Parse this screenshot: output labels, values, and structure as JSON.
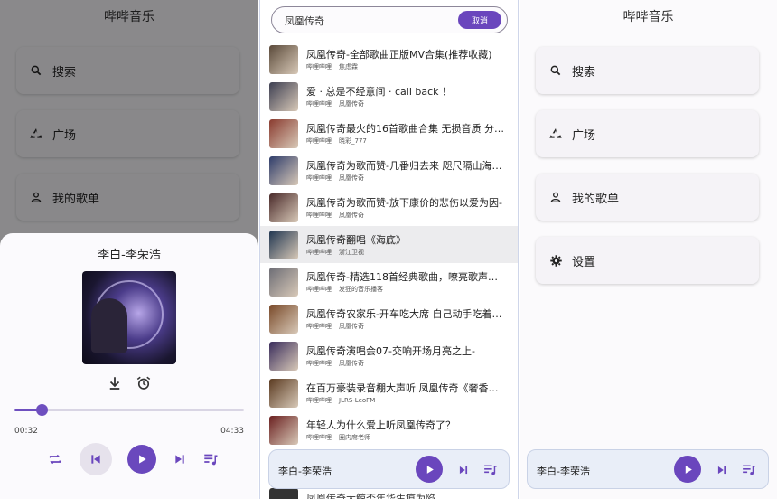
{
  "home": {
    "app_title": "哔哔音乐",
    "menu": [
      {
        "label": "搜索",
        "icon": "search-icon"
      },
      {
        "label": "广场",
        "icon": "recycle-icon"
      },
      {
        "label": "我的歌单",
        "icon": "person-icon"
      },
      {
        "label": "设置",
        "icon": "gear-icon"
      }
    ]
  },
  "player_sheet": {
    "title": "李白-李荣浩",
    "elapsed": "00:32",
    "duration": "04:33",
    "progress_fraction": 0.117
  },
  "search": {
    "query": "凤凰传奇",
    "placeholder": "",
    "cancel_label": "取消",
    "results": [
      {
        "title": "凤凰传奇-全部歌曲正版MV合集(推荐收藏)",
        "source": "哔哩哔哩",
        "uploader": "焦虑霖"
      },
      {
        "title": "爱 · 总是不经意间 · call back ！",
        "source": "哔哩哔哩",
        "uploader": "凤凰传奇"
      },
      {
        "title": "凤凰传奇最火的16首歌曲合集 无损音质 分P...",
        "source": "哔哩哔哩",
        "uploader": "晓彩_777"
      },
      {
        "title": "凤凰传奇为歌而赞-几番归去来 咫尺隔山海染-",
        "source": "哔哩哔哩",
        "uploader": "凤凰传奇"
      },
      {
        "title": "凤凰传奇为歌而赞-放下康价的悲伤以爱为因-",
        "source": "哔哩哔哩",
        "uploader": "凤凰传奇"
      },
      {
        "title": "凤凰传奇翻唱《海底》",
        "source": "哔哩哔哩",
        "uploader": "浙江卫视"
      },
      {
        "title": "凤凰传奇-精选118首经典歌曲，嘹亮歌声醉...",
        "source": "哔哩哔哩",
        "uploader": "发狂的音乐播客"
      },
      {
        "title": "凤凰传奇农家乐-开车吃大席 自己动手吃着更香",
        "source": "哔哩哔哩",
        "uploader": "凤凰传奇"
      },
      {
        "title": "凤凰传奇演唱会07-交响开场月亮之上-",
        "source": "哔哩哔哩",
        "uploader": "凤凰传奇"
      },
      {
        "title": "在百万豪装录音棚大声听 凤凰传奇《奢香夫人...",
        "source": "哔哩哔哩",
        "uploader": "JLRS-LeoFM"
      },
      {
        "title": "年轻人为什么爱上听凤凰传奇了？",
        "source": "哔哩哔哩",
        "uploader": "圈内席老师"
      }
    ],
    "partial_row": "凤凰传奇大鲸否年华生痕为陷"
  },
  "mini_player": {
    "track": "李白-李荣浩"
  },
  "colors": {
    "accent": "#6a46bd",
    "selected_row": "#ececee"
  }
}
